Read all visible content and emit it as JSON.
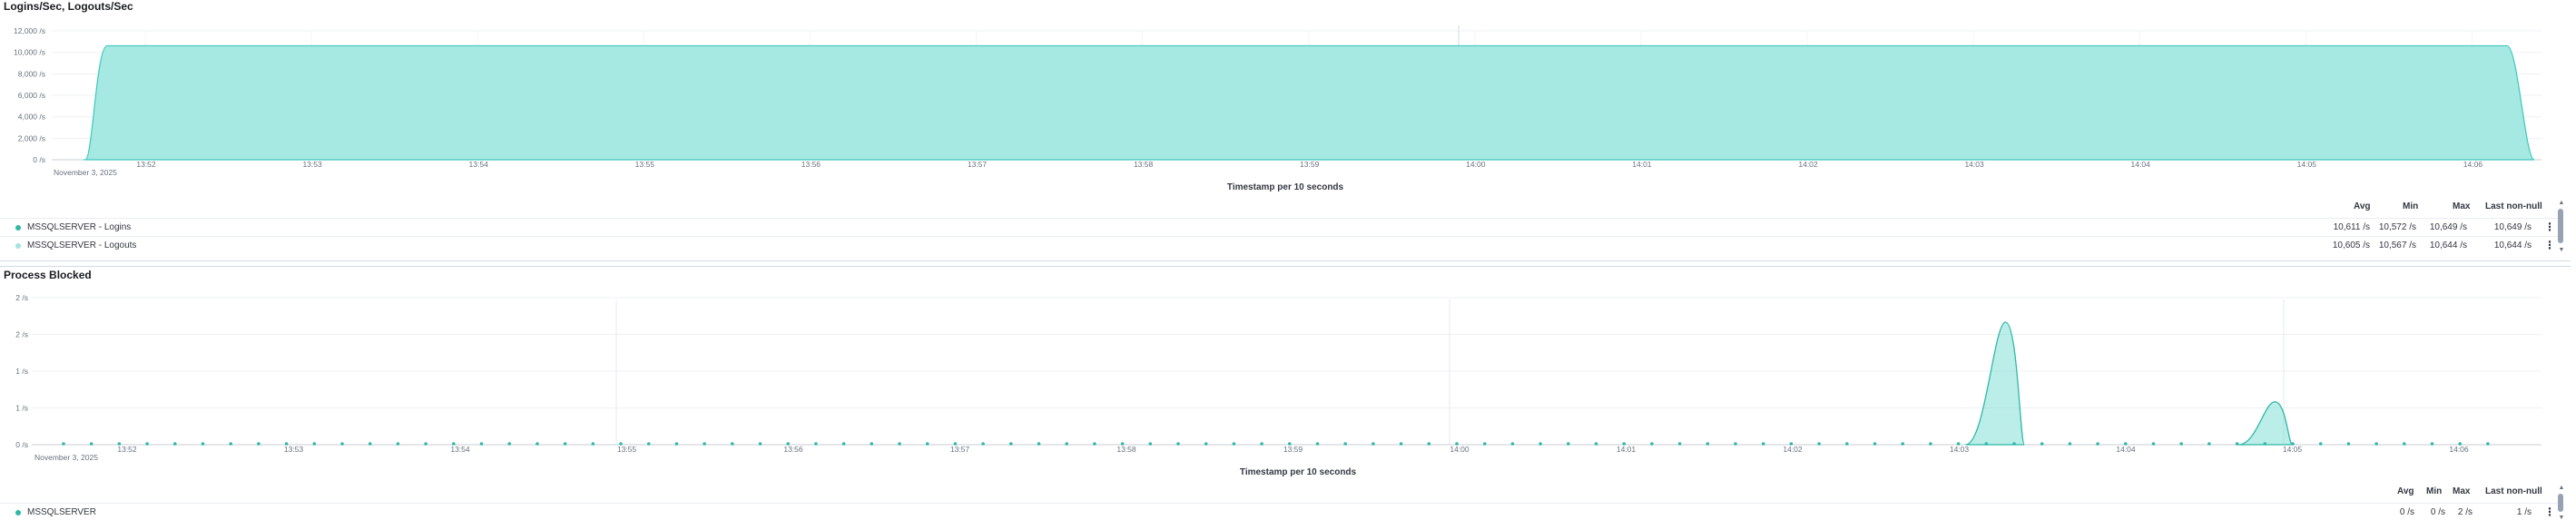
{
  "panels": [
    {
      "title": "Logins/Sec, Logouts/Sec",
      "chart_data": {
        "type": "area",
        "title": "Logins/Sec, Logouts/Sec",
        "xlabel": "Timestamp per 10 seconds",
        "x_date_label": "November 3, 2025",
        "x_ticks": [
          "13:52",
          "13:53",
          "13:54",
          "13:55",
          "13:56",
          "13:57",
          "13:58",
          "13:59",
          "14:00",
          "14:01",
          "14:02",
          "14:03",
          "14:04",
          "14:05",
          "14:06"
        ],
        "y_ticks": [
          "0 /s",
          "2,000 /s",
          "4,000 /s",
          "6,000 /s",
          "8,000 /s",
          "10,000 /s",
          "12,000 /s"
        ],
        "ylim": [
          0,
          12000
        ],
        "unit": "/s",
        "series": [
          {
            "name": "MSSQLSERVER - Logins",
            "color": "#54b399",
            "points": [
              [
                13.857,
                0
              ],
              [
                13.86,
                0
              ],
              [
                13.862,
                10611
              ],
              [
                14.105,
                10611
              ],
              [
                14.108,
                0
              ]
            ]
          },
          {
            "name": "MSSQLSERVER - Logouts",
            "color": "#6dccb1",
            "points": [
              [
                13.857,
                0
              ],
              [
                13.86,
                0
              ],
              [
                13.862,
                10605
              ],
              [
                14.105,
                10605
              ],
              [
                14.108,
                0
              ]
            ]
          }
        ]
      },
      "legend": {
        "headers": {
          "avg": "Avg",
          "min": "Min",
          "max": "Max",
          "last": "Last non-null"
        },
        "rows": [
          {
            "name": "MSSQLSERVER - Logins",
            "color": "#2fb8a8",
            "avg": "10,611 /s",
            "min": "10,572 /s",
            "max": "10,649 /s",
            "last": "10,649 /s",
            "menu": "⋮"
          },
          {
            "name": "MSSQLSERVER - Logouts",
            "color": "#a5e3dc",
            "avg": "10,605 /s",
            "min": "10,567 /s",
            "max": "10,644 /s",
            "last": "10,644 /s",
            "menu": "⋮"
          }
        ]
      }
    },
    {
      "title": "Process Blocked",
      "chart_data": {
        "type": "area",
        "title": "Process Blocked",
        "xlabel": "Timestamp per 10 seconds",
        "x_date_label": "November 3, 2025",
        "x_ticks": [
          "13:52",
          "13:53",
          "13:54",
          "13:55",
          "13:56",
          "13:57",
          "13:58",
          "13:59",
          "14:00",
          "14:01",
          "14:02",
          "14:03",
          "14:04",
          "14:05",
          "14:06"
        ],
        "y_ticks": [
          "0 /s",
          "1 /s",
          "1 /s",
          "2 /s",
          "2 /s"
        ],
        "ylim": [
          0,
          2.4
        ],
        "unit": "/s",
        "series": [
          {
            "name": "MSSQLSERVER",
            "color": "#2fb8a8",
            "peaks": [
              {
                "x_minutes_from_1352": 10.7,
                "value": 2.0
              },
              {
                "x_minutes_from_1352": 12.6,
                "value": 0.7
              }
            ]
          }
        ]
      },
      "legend": {
        "headers": {
          "avg": "Avg",
          "min": "Min",
          "max": "Max",
          "last": "Last non-null"
        },
        "rows": [
          {
            "name": "MSSQLSERVER",
            "color": "#2fb8a8",
            "avg": "0 /s",
            "min": "0 /s",
            "max": "2 /s",
            "last": "1 /s",
            "menu": "⋮"
          }
        ]
      }
    }
  ]
}
